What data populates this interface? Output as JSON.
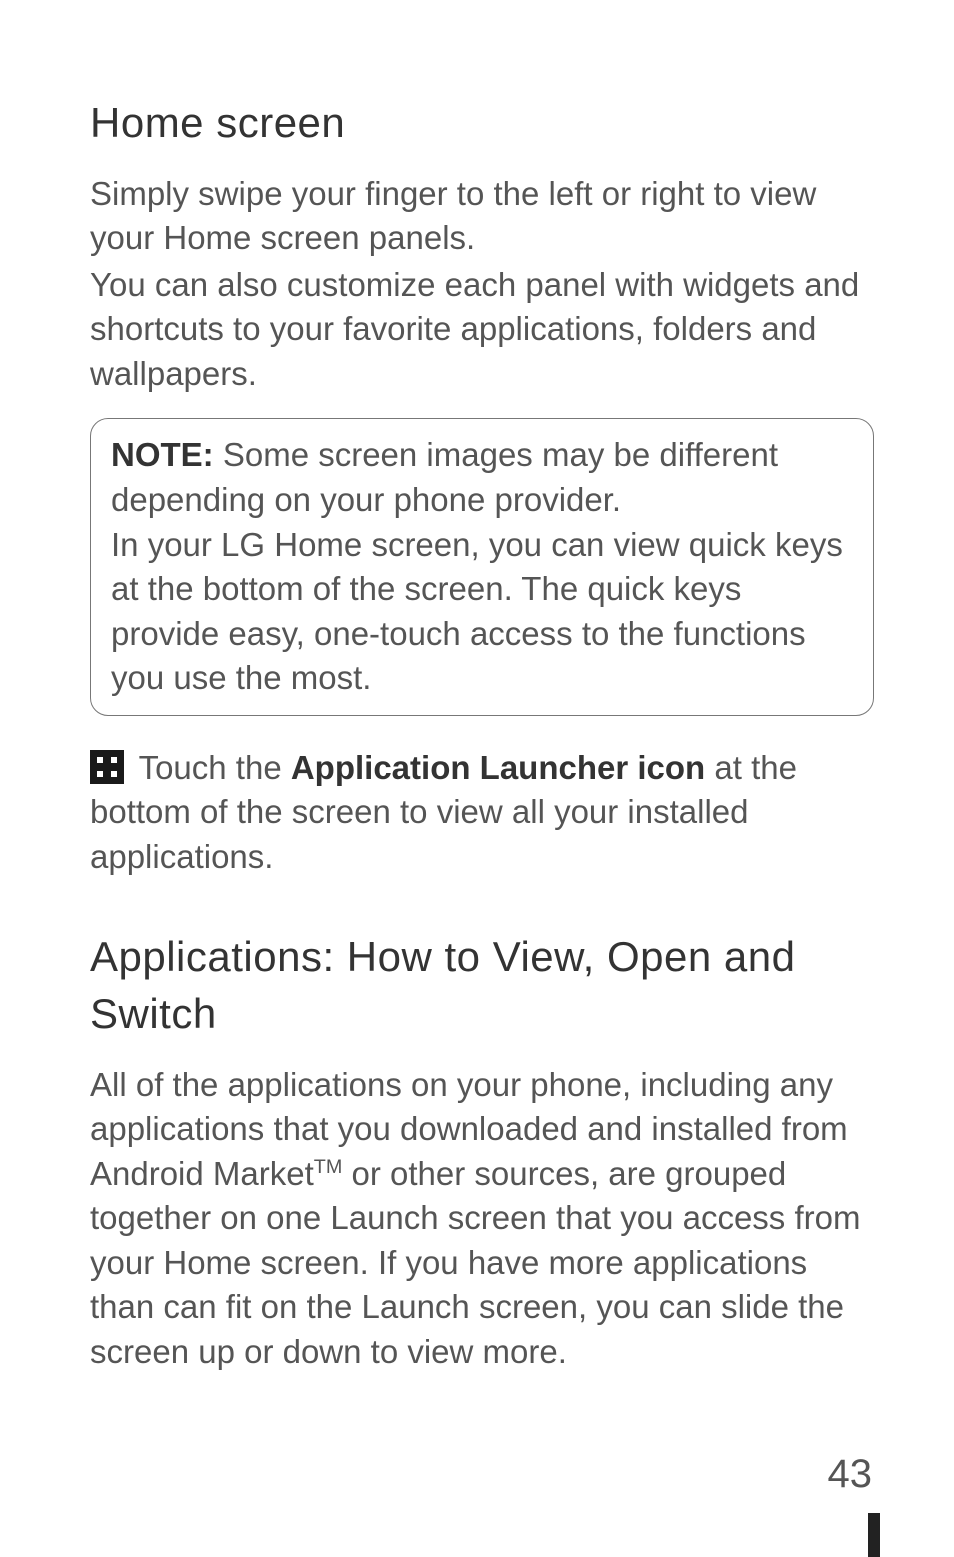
{
  "sections": {
    "homeScreen": {
      "heading": "Home screen",
      "para1": "Simply swipe your finger to the left or right to view your Home screen panels.",
      "para2": "You can also customize each panel with widgets and shortcuts to your favorite applications, folders and wallpapers."
    },
    "note": {
      "label": "NOTE:",
      "text1": " Some screen images may be different depending on your phone provider.",
      "text2": "In your LG Home screen, you can view quick keys at the bottom of the screen. The quick keys provide easy, one-touch access to the functions you use the most."
    },
    "launcher": {
      "prefix": " Touch the ",
      "bold": "Application Launcher icon",
      "suffix": " at the bottom of the screen to view all your installed applications."
    },
    "apps": {
      "heading": "Applications: How to View, Open and Switch",
      "para_a": "All of the applications on your phone, including any applications that you downloaded and installed from Android Market",
      "tm": "TM",
      "para_b": " or other sources, are grouped together on one Launch screen that you access from your Home screen. If you have more applications than can fit on the Launch screen, you can slide the screen up or down to view more."
    }
  },
  "page": {
    "number": "43"
  },
  "icons": {
    "launcher": "application-launcher-icon"
  }
}
